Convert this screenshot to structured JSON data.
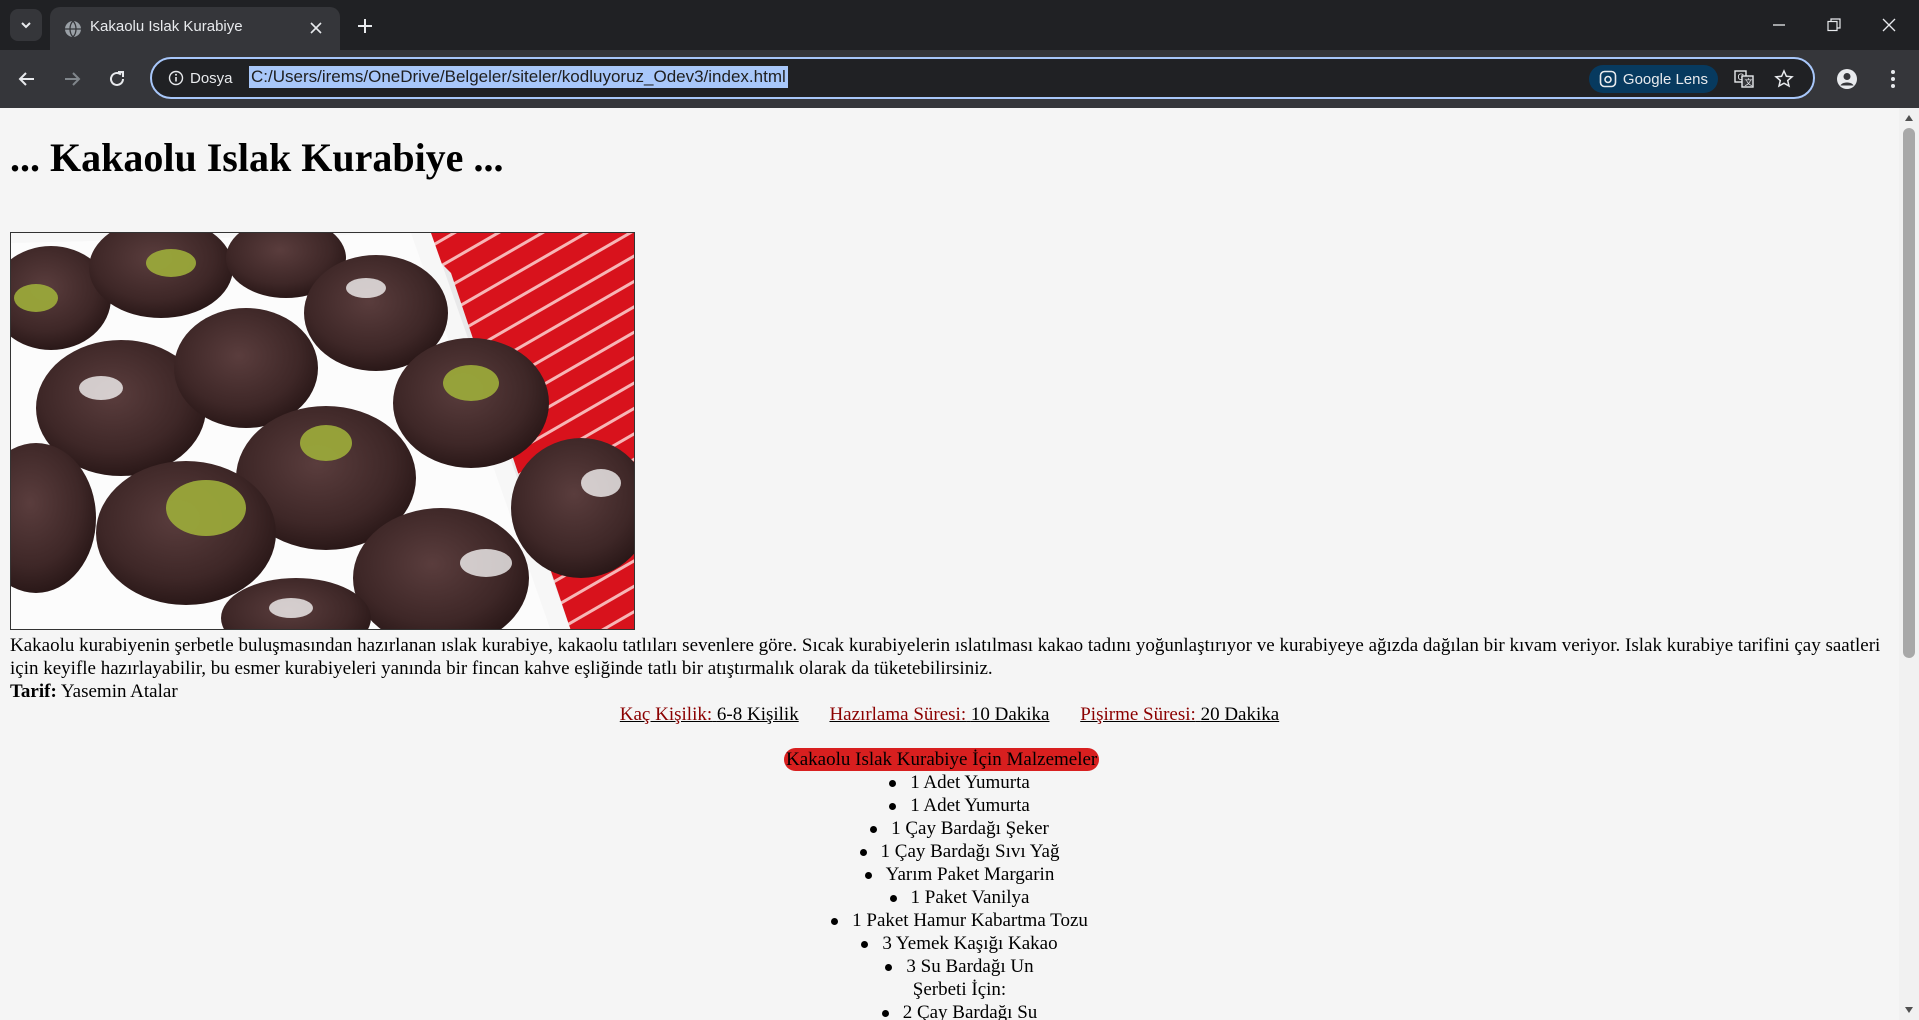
{
  "browser": {
    "tab_title": "Kakaolu Islak Kurabiye",
    "site_chip": "Dosya",
    "url": "C:/Users/irems/OneDrive/Belgeler/siteler/kodluyoruz_Odev3/index.html",
    "lens_label": "Google Lens"
  },
  "page": {
    "title": "... Kakaolu Islak Kurabiye ...",
    "intro": "Kakaolu kurabiyenin şerbetle buluşmasından hazırlanan ıslak kurabiye, kakaolu tatlıları sevenlere göre. Sıcak kurabiyelerin ıslatılması kakao tadını yoğunlaştırıyor ve kurabiyeye ağızda dağılan bir kıvam veriyor. Islak kurabiye tarifini çay saatleri için keyifle hazırlayabilir, bu esmer kurabiyeleri yanında bir fincan kahve eşliğinde tatlı bir atıştırmalık olarak da tüketebilirsiniz.",
    "author_label": "Tarif:",
    "author_name": "Yasemin Atalar",
    "meta": [
      {
        "key": "Kaç Kişilik:",
        "value": "6-8 Kişilik"
      },
      {
        "key": "Hazırlama Süresi:",
        "value": "10 Dakika"
      },
      {
        "key": "Pişirme Süresi:",
        "value": "20 Dakika"
      }
    ],
    "ingredients_title": "Kakaolu Islak Kurabiye İçin Malzemeler",
    "ingredients": [
      "1 Adet Yumurta",
      "1 Adet Yumurta",
      "1 Çay Bardağı Şeker",
      "1 Çay Bardağı Sıvı Yağ",
      "Yarım Paket Margarin",
      "1 Paket Vanilya",
      "1 Paket Hamur Kabartma Tozu",
      "3 Yemek Kaşığı Kakao",
      "3 Su Bardağı Un"
    ],
    "syrup_title": "Şerbeti İçin:",
    "syrup": [
      "2 Çay Bardağı Su"
    ]
  },
  "colors": {
    "accent_pill": "#d81f1f",
    "meta_key": "#8b0000"
  }
}
